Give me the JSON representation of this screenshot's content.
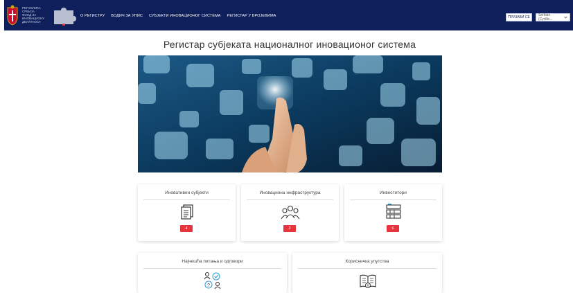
{
  "header": {
    "fund_name_lines": [
      "РЕПУБЛИКА СРБИЈА",
      "ФОНД ЗА",
      "ИНОВАЦИОНУ",
      "ДЕЛАТНОСТ"
    ],
    "nav": [
      {
        "label": "О РЕГИСТРУ"
      },
      {
        "label": "ВОДИЧ ЗА УПИС"
      },
      {
        "label": "СУБЈЕКТИ ИНОВАЦИОНОГ СИСТЕМА"
      },
      {
        "label": "РЕГИСТАР У БРОЈЕВИМА"
      }
    ],
    "login_label": "ПРИЈАВИ СЕ",
    "language_selected": "Serbian (Cyrillic..."
  },
  "main": {
    "title": "Регистар субјеката националног иновационог система"
  },
  "cards_row1": [
    {
      "title": "Иновативни субјекти",
      "icon": "documents-icon",
      "count": "4"
    },
    {
      "title": "Иновациона инфраструктура",
      "icon": "people-group-icon",
      "count": "2"
    },
    {
      "title": "Инвеститори",
      "icon": "investors-icon",
      "count": "6"
    }
  ],
  "cards_row2": [
    {
      "title": "Најчешћа питања и одговори",
      "icon": "faq-icon"
    },
    {
      "title": "Корисничка упутства",
      "icon": "manual-book-icon"
    }
  ],
  "colors": {
    "header_bg": "#0e1f5b",
    "badge": "#e8343f"
  }
}
